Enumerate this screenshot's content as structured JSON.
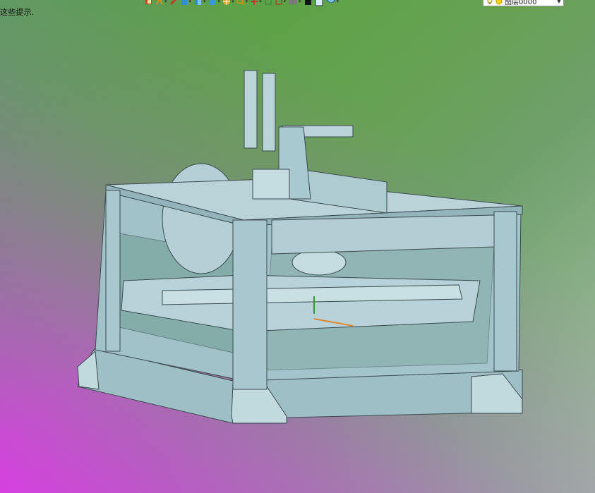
{
  "window": {
    "hint_text": "这些提示."
  },
  "toolbar": {
    "icons": [
      "view-orient-icon",
      "section-icon",
      "pen-icon",
      "display-style-icon",
      "hide-show-icon",
      "edit-appearance-icon",
      "scene-icon",
      "view-settings-icon",
      "triad-icon",
      "sketch-icon",
      "rectangle-icon",
      "printer-icon",
      "black-square-icon",
      "blue-square-icon",
      "layers-icon"
    ],
    "layer_label": "图层0000"
  },
  "colors": {
    "model_fill": "#a9c9d0",
    "model_edge": "#3b4a4e",
    "bg_green": "#5da334",
    "bg_magenta": "#d640e0"
  }
}
